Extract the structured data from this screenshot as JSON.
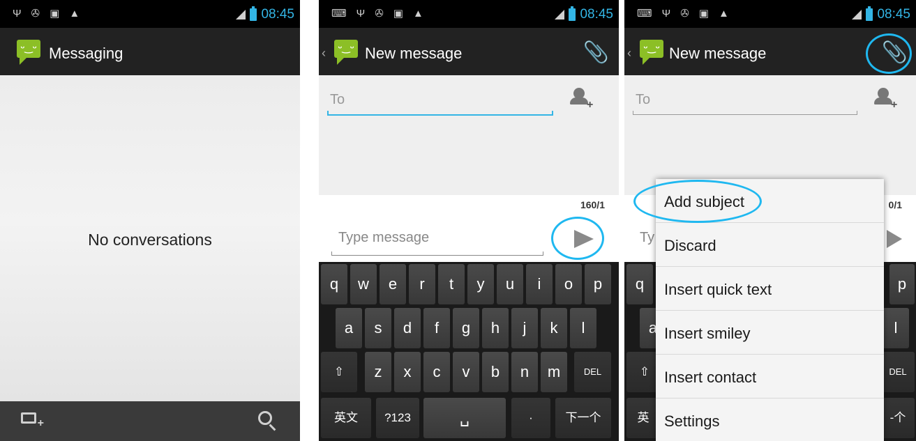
{
  "status_bar": {
    "time": "08:45"
  },
  "screen1": {
    "title": "Messaging",
    "empty_text": "No conversations"
  },
  "screen2": {
    "title": "New message",
    "to_placeholder": "To",
    "counter": "160/1",
    "type_placeholder": "Type message",
    "keyboard": {
      "row1": [
        "q",
        "w",
        "e",
        "r",
        "t",
        "y",
        "u",
        "i",
        "o",
        "p"
      ],
      "row2": [
        "a",
        "s",
        "d",
        "f",
        "g",
        "h",
        "j",
        "k",
        "l"
      ],
      "row3": [
        "z",
        "x",
        "c",
        "v",
        "b",
        "n",
        "m"
      ],
      "shift_label": "⇧",
      "del_label": "DEL",
      "lang_label": "英文",
      "sym_label": "?123",
      "space_label": "␣",
      "period_label": "·",
      "next_label": "下一个"
    }
  },
  "screen3": {
    "title": "New message",
    "to_placeholder": "To",
    "counter_partial": "0/1",
    "type_partial": "Ty",
    "keys_visible": {
      "q": "q",
      "p": "p",
      "a": "a",
      "l": "l",
      "del": "DEL",
      "lang": "英",
      "next": "-个"
    },
    "menu": [
      "Add subject",
      "Discard",
      "Insert quick text",
      "Insert smiley",
      "Insert contact",
      "Settings"
    ]
  },
  "colors": {
    "accent": "#33b5e5",
    "highlight": "#1fb8f0",
    "app_green": "#8cbf26",
    "actionbar": "#222222"
  },
  "icons": [
    "usb-icon",
    "android-debug-icon",
    "picture-icon",
    "warning-icon",
    "signal-icon",
    "battery-icon",
    "messaging-app-icon",
    "compose-icon",
    "search-icon",
    "attach-icon",
    "add-contact-icon",
    "send-icon"
  ]
}
